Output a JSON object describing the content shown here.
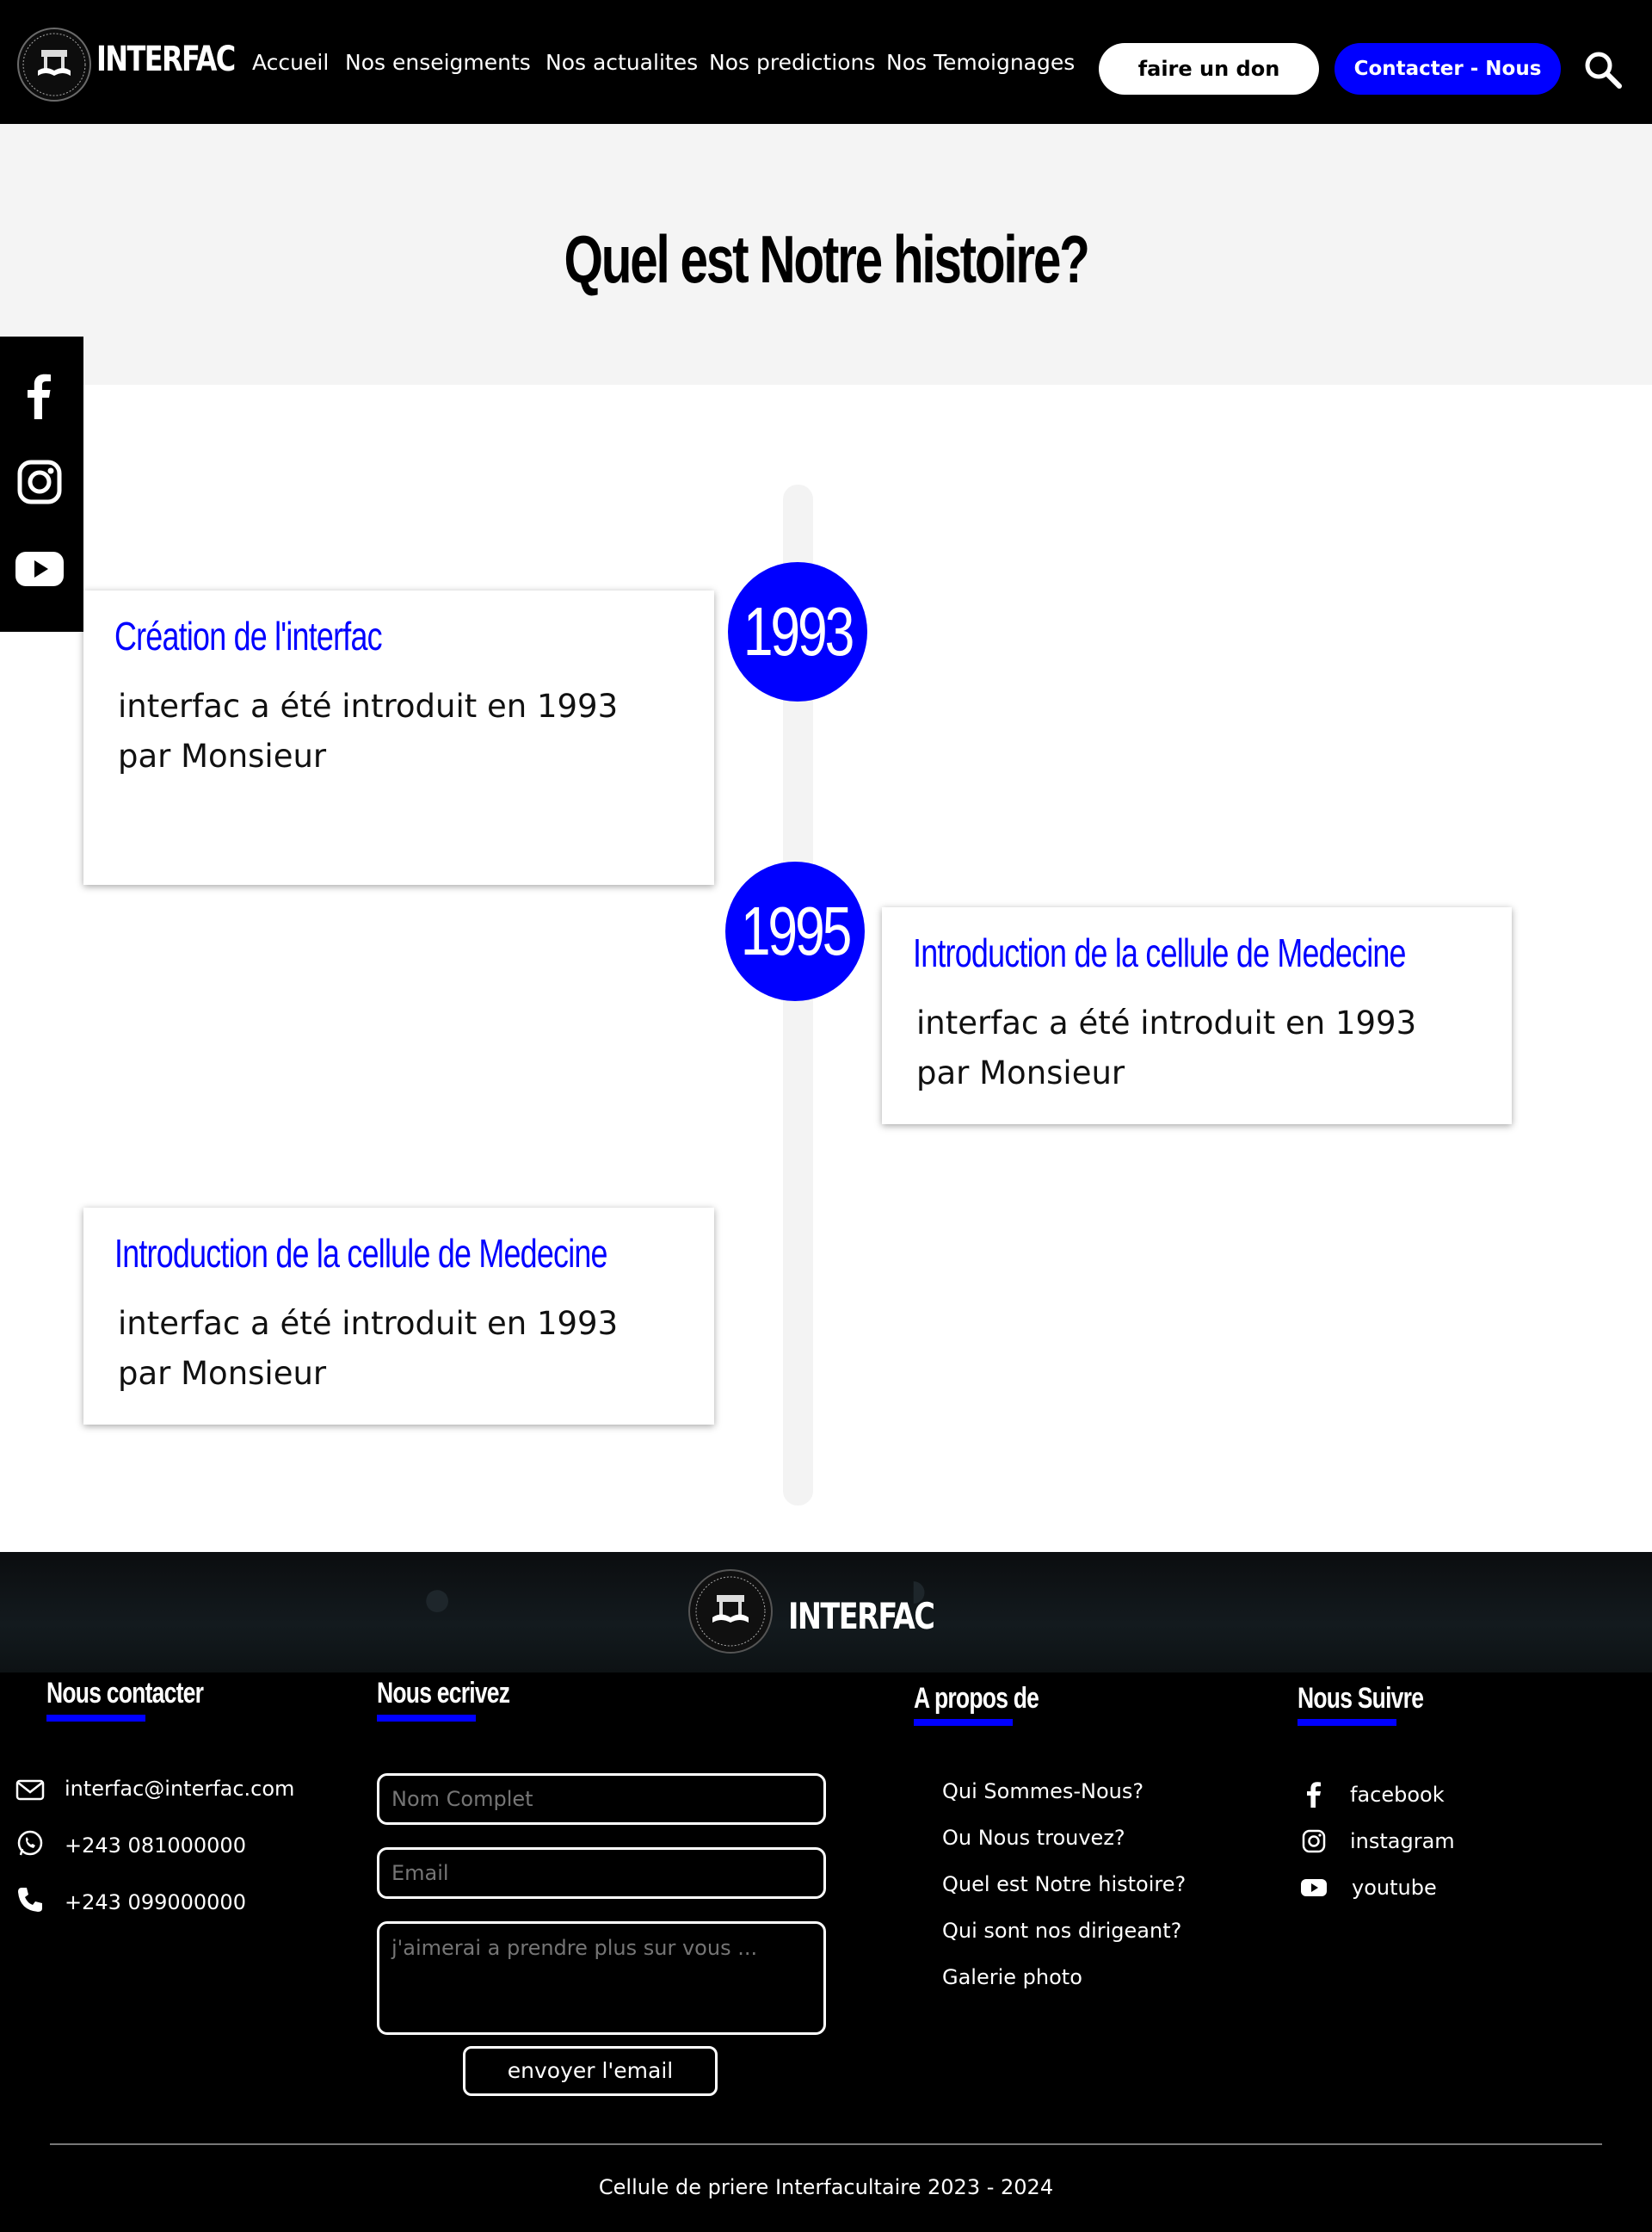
{
  "header": {
    "brand": "INTERFAC",
    "nav": [
      "Accueil",
      "Nos enseigments",
      "Nos actualites",
      "Nos predictions",
      "Nos Temoignages"
    ],
    "donate_label": "faire un don",
    "contact_label": "Contacter - Nous"
  },
  "hero": {
    "title": "Quel est Notre histoire?"
  },
  "social_sidebar": [
    "facebook-icon",
    "instagram-icon",
    "youtube-icon"
  ],
  "timeline": {
    "years": [
      "1993",
      "1995"
    ],
    "entries": [
      {
        "title": "Création de l'interfac",
        "line1": "interfac a été introduit en 1993",
        "line2": "par Monsieur"
      },
      {
        "title": "Introduction de la cellule de Medecine",
        "line1": "interfac a été introduit en 1993",
        "line2": "par Monsieur"
      },
      {
        "title": "Introduction de la cellule de Medecine",
        "line1": "interfac a été introduit en 1993",
        "line2": "par Monsieur"
      }
    ]
  },
  "footer": {
    "brand": "INTERFAC",
    "contact": {
      "heading": "Nous contacter",
      "email": "interfac@interfac.com",
      "whatsapp": "+243 081000000",
      "phone": "+243 099000000"
    },
    "write": {
      "heading": "Nous ecrivez",
      "name_placeholder": "Nom Complet",
      "email_placeholder": "Email",
      "message_placeholder": "j'aimerai a prendre plus sur vous ...",
      "send_label": "envoyer l'email"
    },
    "about": {
      "heading": "A propos de",
      "links": [
        "Qui Sommes-Nous?",
        "Ou Nous trouvez?",
        "Quel est Notre histoire?",
        "Qui sont nos dirigeant?",
        "Galerie photo"
      ]
    },
    "follow": {
      "heading": "Nous Suivre",
      "links": [
        "facebook",
        "instagram",
        "youtube"
      ]
    },
    "copyright": "Cellule de priere  Interfacultaire 2023 - 2024"
  },
  "colors": {
    "accent": "#0000ff",
    "header_bg": "#000000",
    "hero_bg": "#f4f4f4",
    "timeline_line": "#f3f3f3"
  }
}
